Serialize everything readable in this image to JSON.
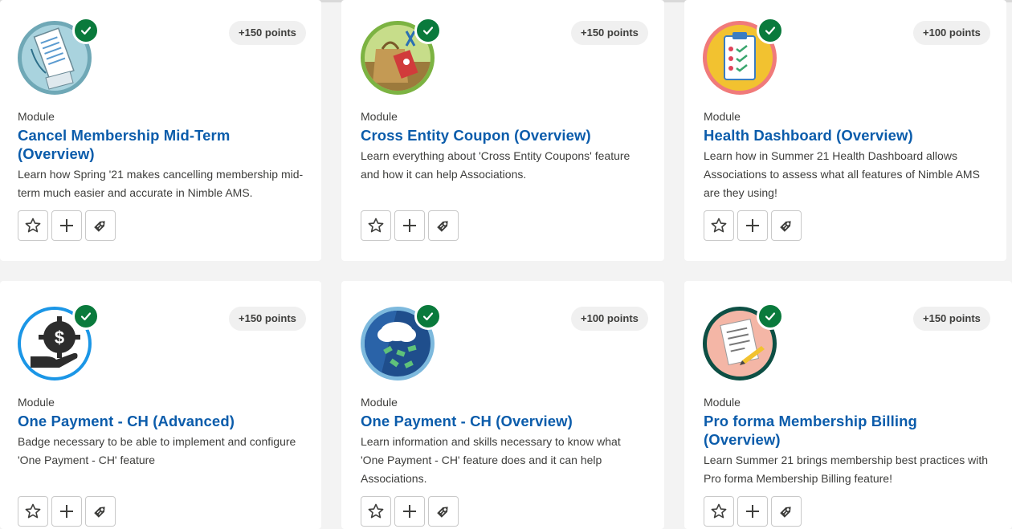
{
  "cards": [
    {
      "type": "Module",
      "title": "Cancel Membership Mid-Term (Overview)",
      "description": "Learn how Spring '21 makes cancelling membership mid-term much easier and accurate in Nimble AMS.",
      "points": "+150 points",
      "badge_icon": "receipt-document-icon",
      "completed": true
    },
    {
      "type": "Module",
      "title": "Cross Entity Coupon (Overview)",
      "description": "Learn everything about 'Cross Entity Coupons' feature and how it can help Associations.",
      "points": "+150 points",
      "badge_icon": "shopping-bag-coupon-icon",
      "completed": true
    },
    {
      "type": "Module",
      "title": "Health Dashboard (Overview)",
      "description": "Learn how in Summer 21 Health Dashboard allows Associations to assess what all features of Nimble AMS are they using!",
      "points": "+100 points",
      "badge_icon": "clipboard-checklist-icon",
      "completed": true
    },
    {
      "type": "Module",
      "title": "One Payment - CH (Advanced)",
      "description": "Badge necessary to be able to implement and configure 'One Payment - CH' feature",
      "points": "+150 points",
      "badge_icon": "hand-money-gear-icon",
      "completed": true
    },
    {
      "type": "Module",
      "title": "One Payment - CH (Overview)",
      "description": "Learn information and skills necessary to know what 'One Payment - CH' feature does and it can help Associations.",
      "points": "+100 points",
      "badge_icon": "money-rain-cloud-icon",
      "completed": true
    },
    {
      "type": "Module",
      "title": "Pro forma Membership Billing (Overview)",
      "description": "Learn Summer 21 brings membership best practices with Pro forma Membership Billing feature!",
      "points": "+150 points",
      "badge_icon": "document-pencil-icon",
      "completed": true
    }
  ],
  "actions": {
    "favorite_icon": "star-icon",
    "add_icon": "plus-icon",
    "tag_icon": "tag-icon"
  },
  "colors": {
    "title_link": "#0b5cab",
    "completed_check": "#0a7a3c",
    "background": "#f3f3f3"
  }
}
